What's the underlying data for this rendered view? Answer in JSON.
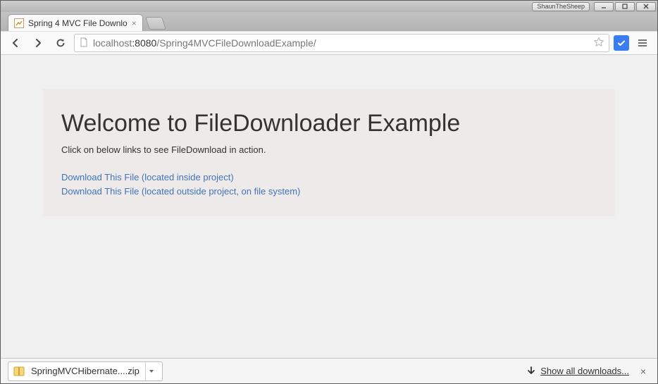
{
  "os": {
    "user_badge": "ShaunTheSheep"
  },
  "tab": {
    "title": "Spring 4 MVC File Downlo"
  },
  "omnibox": {
    "host": "localhost",
    "port": ":8080",
    "path": "/Spring4MVCFileDownloadExample/"
  },
  "page": {
    "heading": "Welcome to FileDownloader Example",
    "instructions": "Click on below links to see FileDownload in action.",
    "link_internal": "Download This File (located inside project)",
    "link_external": "Download This File (located outside project, on file system)"
  },
  "download_bar": {
    "file_name": "SpringMVCHibernate....zip",
    "show_all": "Show all downloads..."
  }
}
